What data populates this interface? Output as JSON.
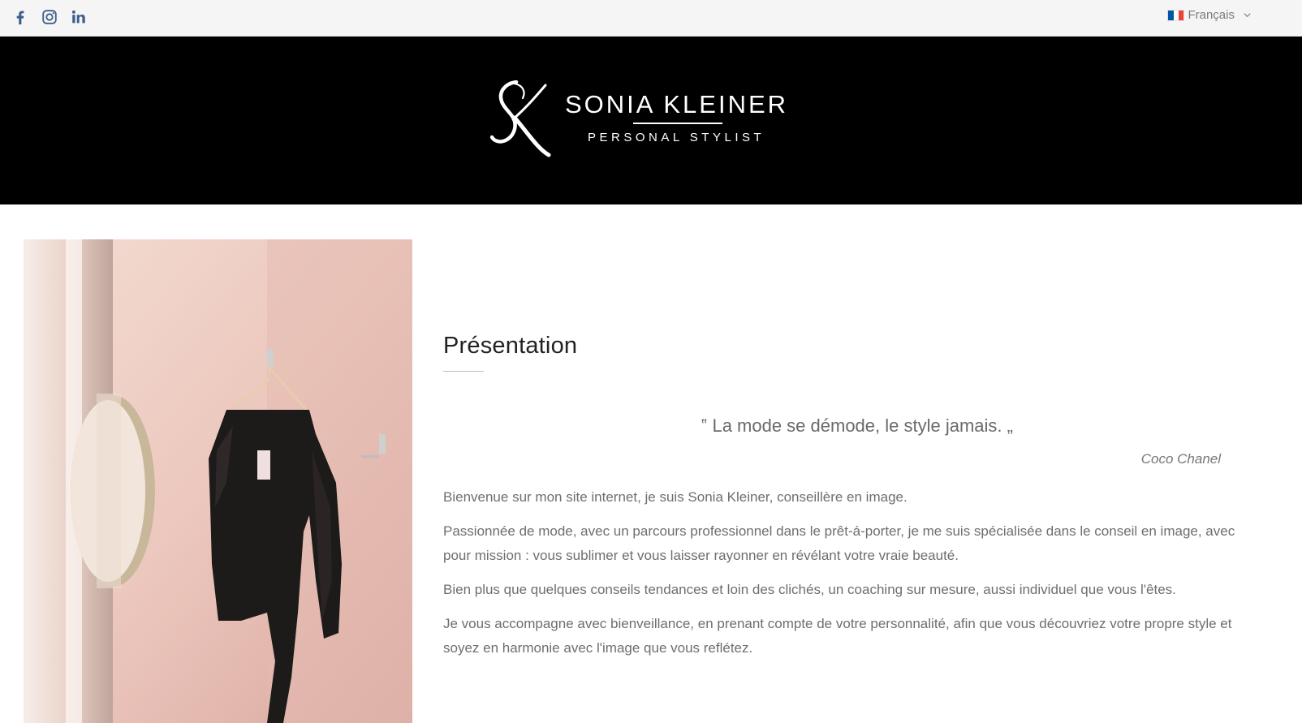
{
  "topbar": {
    "social": [
      {
        "icon": "facebook-icon"
      },
      {
        "icon": "instagram-icon"
      },
      {
        "icon": "linkedin-icon"
      }
    ],
    "language": {
      "label": "Français",
      "flag_colors": [
        "#0055A4",
        "#FFFFFF",
        "#EF4135"
      ]
    }
  },
  "header": {
    "brand_name": "SONIA KLEINER",
    "brand_tagline": "PERSONAL STYLIST",
    "background": "#000000"
  },
  "main": {
    "title": "Présentation",
    "quote": "‟ La mode se démode, le style jamais. „",
    "quote_author": "Coco Chanel",
    "paragraphs": [
      "Bienvenue sur mon site internet, je suis Sonia Kleiner, conseillère en image.",
      "Passionnée de mode, avec un parcours professionnel dans le prêt-á-porter, je me suis spécialisée dans le conseil en image, avec pour mission : vous sublimer et vous laisser rayonner en révélant votre vraie beauté.",
      "Bien plus que quelques conseils tendances et loin des clichés, un coaching sur mesure, aussi individuel que vous l'êtes.",
      "Je vous accompagne avec bienveillance, en prenant compte de votre personnalité, afin que vous découvriez votre propre style et soyez en harmonie avec l'image que vous reflétez."
    ]
  }
}
